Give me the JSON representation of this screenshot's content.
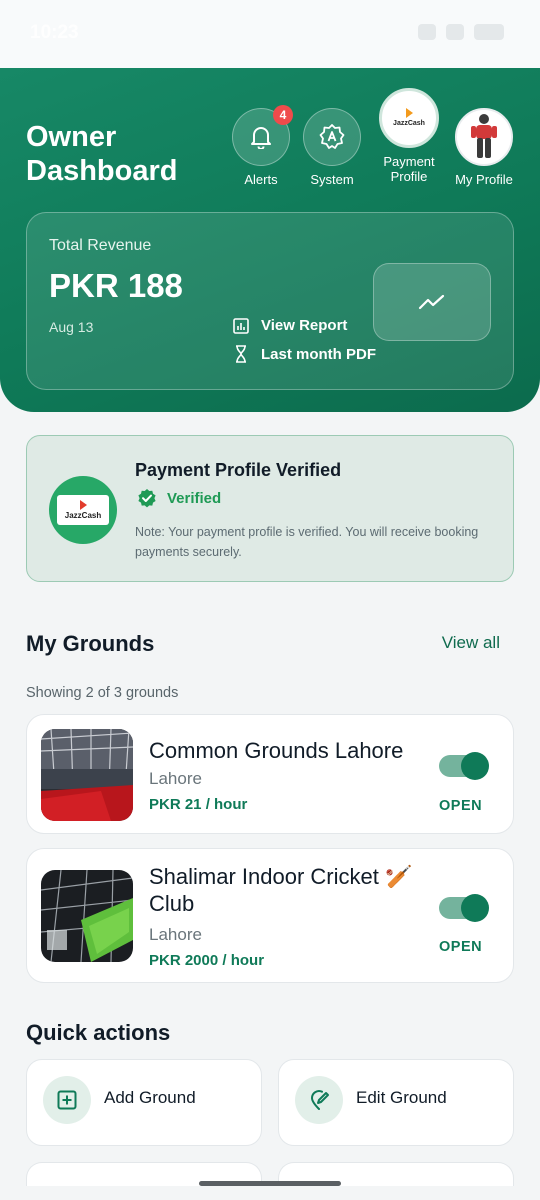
{
  "status_bar": {
    "time": "10:23"
  },
  "header": {
    "title": "Owner Dashboard",
    "buttons": {
      "alerts": {
        "label": "Alerts",
        "badge": "4"
      },
      "system": {
        "label": "System"
      },
      "payment": {
        "label": "Payment Profile",
        "logo_text": "JazzCash"
      },
      "profile": {
        "label": "My Profile"
      }
    },
    "revenue": {
      "label": "Total Revenue",
      "value": "PKR 188",
      "date": "Aug 13",
      "view_report": "View Report",
      "last_month": "Last month PDF"
    }
  },
  "payment_card": {
    "logo_text": "JazzCash",
    "title": "Payment Profile Verified",
    "status": "Verified",
    "note": "Note: Your payment profile is verified. You will receive booking payments securely."
  },
  "grounds": {
    "title": "My Grounds",
    "view_all": "View all",
    "showing": "Showing 2 of 3 grounds",
    "items": [
      {
        "name": "Common Grounds Lahore",
        "city": "Lahore",
        "price": "PKR 21 / hour",
        "status": "OPEN",
        "enabled": true
      },
      {
        "name": "Shalimar Indoor  Cricket 🏏 Club",
        "city": "Lahore",
        "price": "PKR 2000 / hour",
        "status": "OPEN",
        "enabled": true
      }
    ]
  },
  "quick_actions": {
    "title": "Quick actions",
    "items": [
      {
        "label": "Add Ground",
        "icon": "plus-square-icon"
      },
      {
        "label": "Edit Ground",
        "icon": "edit-pin-icon"
      }
    ]
  },
  "colors": {
    "primary": "#0f7a58",
    "verified": "#1f9a55",
    "badge": "#ef4b4b"
  }
}
